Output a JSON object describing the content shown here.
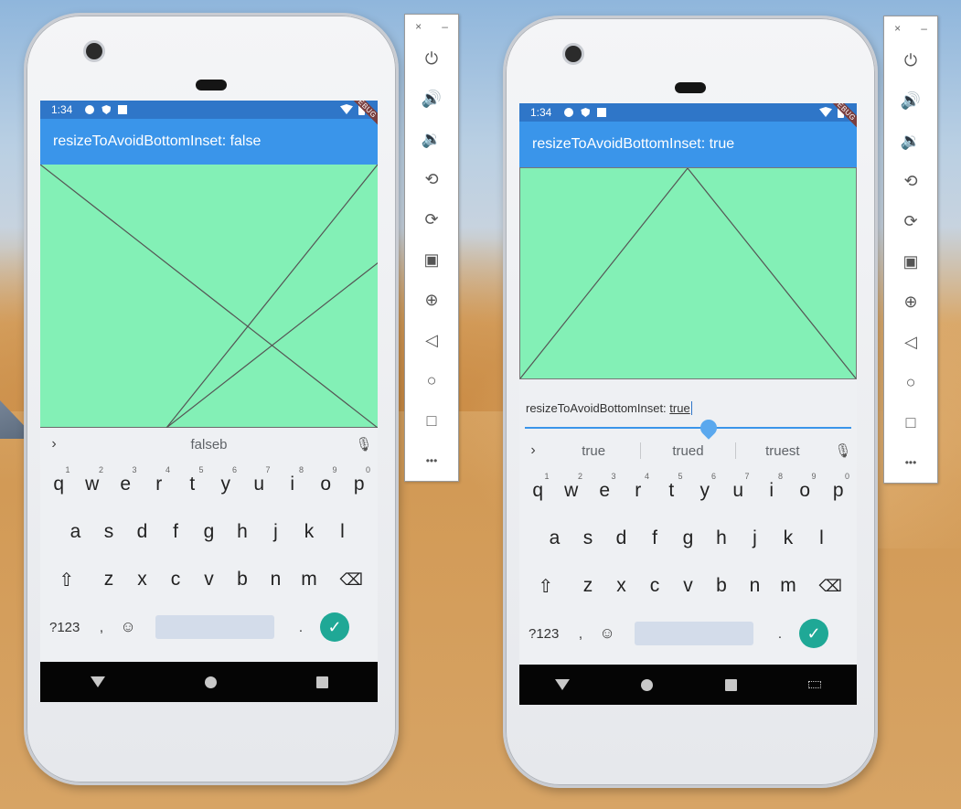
{
  "emulator_left": {
    "status_time": "1:34",
    "debug_label": "DEBUG",
    "appbar_title": "resizeToAvoidBottomInset: false",
    "suggestions": [
      "falseb"
    ],
    "keyboard": {
      "row1": [
        "q",
        "w",
        "e",
        "r",
        "t",
        "y",
        "u",
        "i",
        "o",
        "p"
      ],
      "row1_hints": [
        "1",
        "2",
        "3",
        "4",
        "5",
        "6",
        "7",
        "8",
        "9",
        "0"
      ],
      "row2": [
        "a",
        "s",
        "d",
        "f",
        "g",
        "h",
        "j",
        "k",
        "l"
      ],
      "row3": [
        "z",
        "x",
        "c",
        "v",
        "b",
        "n",
        "m"
      ],
      "sym_label": "?123",
      "comma": ",",
      "period": "."
    }
  },
  "emulator_right": {
    "status_time": "1:34",
    "debug_label": "DEBUG",
    "appbar_title": "resizeToAvoidBottomInset: true",
    "textfield_label": "resizeToAvoidBottomInset: ",
    "textfield_value": "true",
    "suggestions": [
      "true",
      "trued",
      "truest"
    ],
    "keyboard": {
      "row1": [
        "q",
        "w",
        "e",
        "r",
        "t",
        "y",
        "u",
        "i",
        "o",
        "p"
      ],
      "row1_hints": [
        "1",
        "2",
        "3",
        "4",
        "5",
        "6",
        "7",
        "8",
        "9",
        "0"
      ],
      "row2": [
        "a",
        "s",
        "d",
        "f",
        "g",
        "h",
        "j",
        "k",
        "l"
      ],
      "row3": [
        "z",
        "x",
        "c",
        "v",
        "b",
        "n",
        "m"
      ],
      "sym_label": "?123",
      "comma": ",",
      "period": "."
    }
  },
  "toolbar": {
    "close_label": "×",
    "minimize_label": "–",
    "items": [
      "power-icon",
      "volume-up-icon",
      "volume-down-icon",
      "rotate-left-icon",
      "rotate-right-icon",
      "camera-icon",
      "zoom-icon",
      "back-icon",
      "home-icon",
      "overview-icon",
      "more-icon"
    ],
    "more_label": "•••"
  },
  "colors": {
    "appbar": "#3a95ea",
    "statusbar": "#2f76c8",
    "green": "#83f0b6",
    "enter": "#1fa896"
  }
}
